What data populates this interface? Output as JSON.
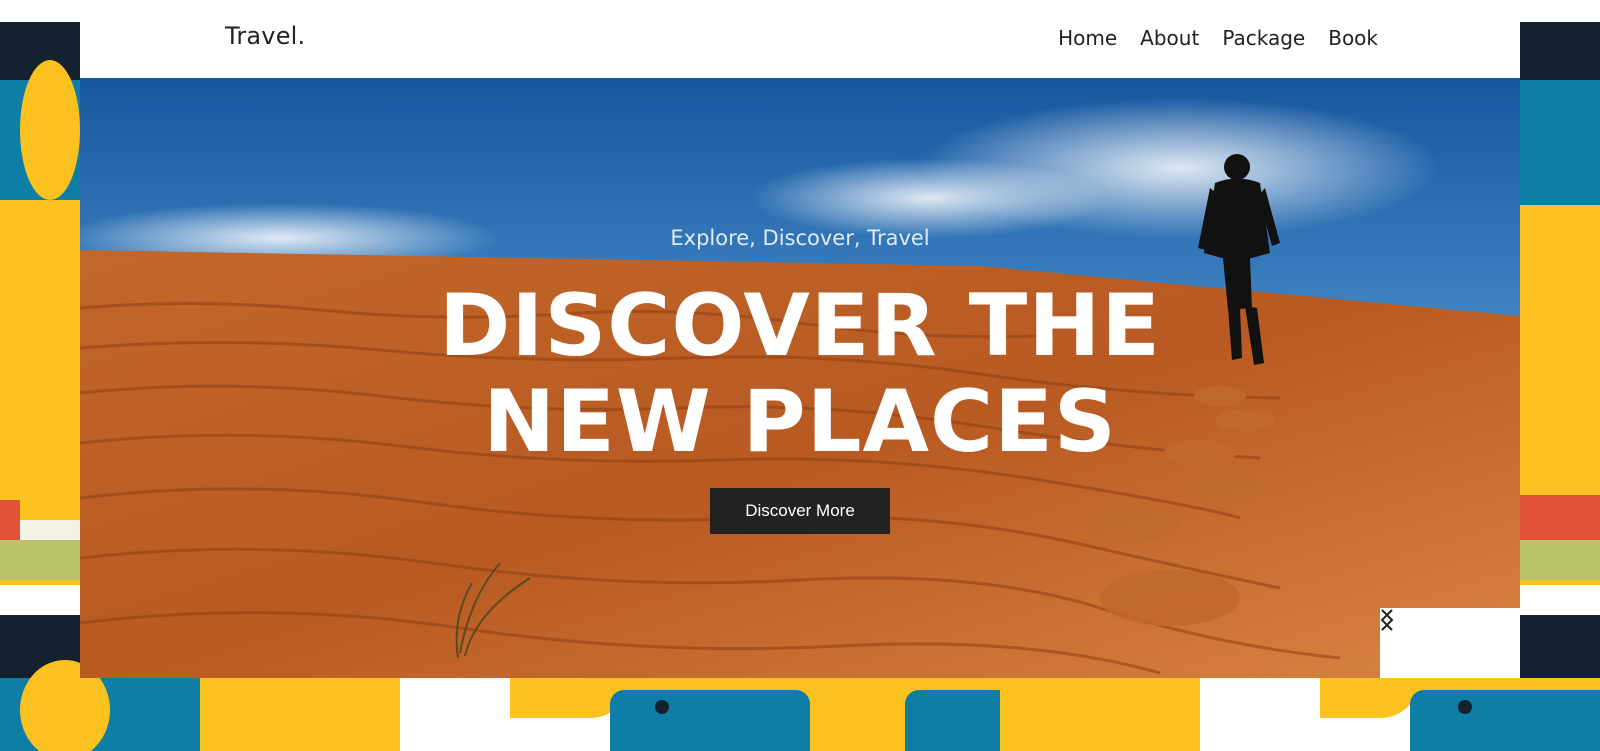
{
  "brand": {
    "name": "Travel."
  },
  "nav": {
    "items": [
      {
        "label": "Home"
      },
      {
        "label": "About"
      },
      {
        "label": "Package"
      },
      {
        "label": "Book"
      }
    ]
  },
  "hero": {
    "kicker": "Explore, Discover, Travel",
    "headline_line1": "DISCOVER THE",
    "headline_line2": "NEW PLACES",
    "cta_label": "Discover More",
    "background_image": "desert dunes with hiker walking uphill under blue sky"
  },
  "slider": {
    "prev_icon": "chevron-left-icon",
    "next_icon": "chevron-right-icon"
  },
  "colors": {
    "accent_dark": "#222222",
    "pattern_yellow": "#fbc21f",
    "pattern_blue": "#0e7ea6",
    "pattern_dark": "#14222f"
  }
}
